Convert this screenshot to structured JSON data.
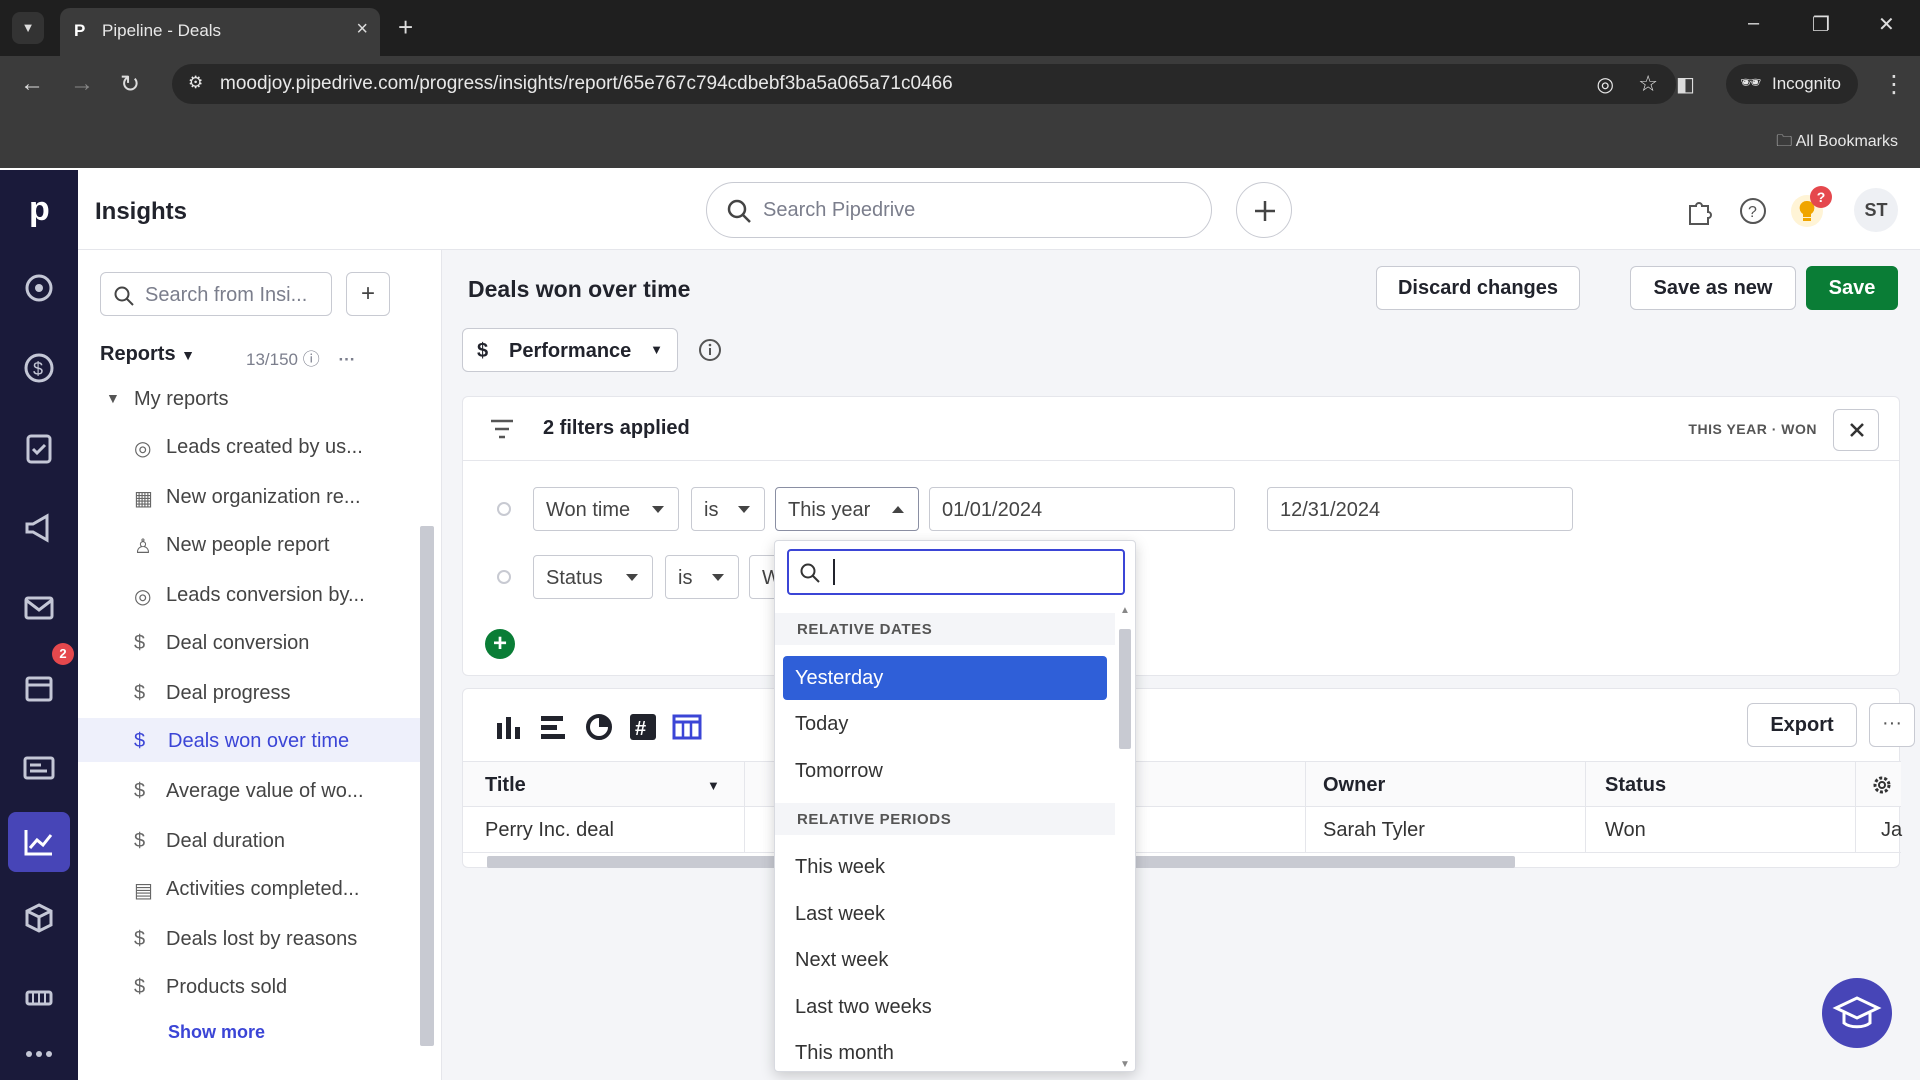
{
  "browser": {
    "tab_title": "Pipeline - Deals",
    "url": "moodjoy.pipedrive.com/progress/insights/report/65e767c794cdbebf3ba5a065a71c0466",
    "incognito_label": "Incognito",
    "bookmarks_label": "All Bookmarks"
  },
  "app": {
    "title": "Insights",
    "search_placeholder": "Search Pipedrive",
    "avatar_initials": "ST",
    "tips_badge": "?",
    "activities_badge": "2"
  },
  "sidebar": {
    "search_placeholder": "Search from Insi...",
    "reports_label": "Reports",
    "reports_count": "13/150",
    "my_reports_label": "My reports",
    "items": [
      {
        "label": "Leads created by us...",
        "icon": "target-icon"
      },
      {
        "label": "New organization re...",
        "icon": "building-icon"
      },
      {
        "label": "New people report",
        "icon": "person-icon"
      },
      {
        "label": "Leads conversion by...",
        "icon": "target-icon"
      },
      {
        "label": "Deal conversion",
        "icon": "dollar-icon"
      },
      {
        "label": "Deal progress",
        "icon": "dollar-icon"
      },
      {
        "label": "Deals won over time",
        "icon": "dollar-icon"
      },
      {
        "label": "Average value of wo...",
        "icon": "dollar-icon"
      },
      {
        "label": "Deal duration",
        "icon": "dollar-icon"
      },
      {
        "label": "Activities completed...",
        "icon": "calendar-icon"
      },
      {
        "label": "Deals lost by reasons",
        "icon": "dollar-icon"
      },
      {
        "label": "Products sold",
        "icon": "dollar-icon"
      }
    ],
    "show_more": "Show more"
  },
  "report": {
    "title": "Deals won over time",
    "discard_label": "Discard changes",
    "save_new_label": "Save as new",
    "save_label": "Save",
    "performance_label": "Performance"
  },
  "filters": {
    "summary": "2 filters applied",
    "tags": "THIS YEAR · WON",
    "row1": {
      "field": "Won time",
      "op": "is",
      "value": "This year",
      "from": "01/01/2024",
      "to": "12/31/2024"
    },
    "row2": {
      "field": "Status",
      "op": "is",
      "value_partial": "W"
    }
  },
  "table": {
    "export_label": "Export",
    "more_label": "···",
    "columns": [
      "Title",
      "Owner",
      "Status"
    ],
    "rows": [
      {
        "title": "Perry Inc. deal",
        "owner": "Sarah Tyler",
        "status": "Won",
        "extra": "Ja"
      }
    ]
  },
  "dropdown": {
    "search_value": "",
    "section_relative_dates": "RELATIVE DATES",
    "relative_dates": [
      "Yesterday",
      "Today",
      "Tomorrow"
    ],
    "section_relative_periods": "RELATIVE PERIODS",
    "relative_periods": [
      "This week",
      "Last week",
      "Next week",
      "Last two weeks",
      "This month"
    ],
    "highlighted": "Yesterday"
  },
  "colors": {
    "accent": "#3b45d6",
    "save_green": "#0a7d36",
    "nav_bg": "#1a1a3a",
    "highlight": "#2f5fd8"
  }
}
